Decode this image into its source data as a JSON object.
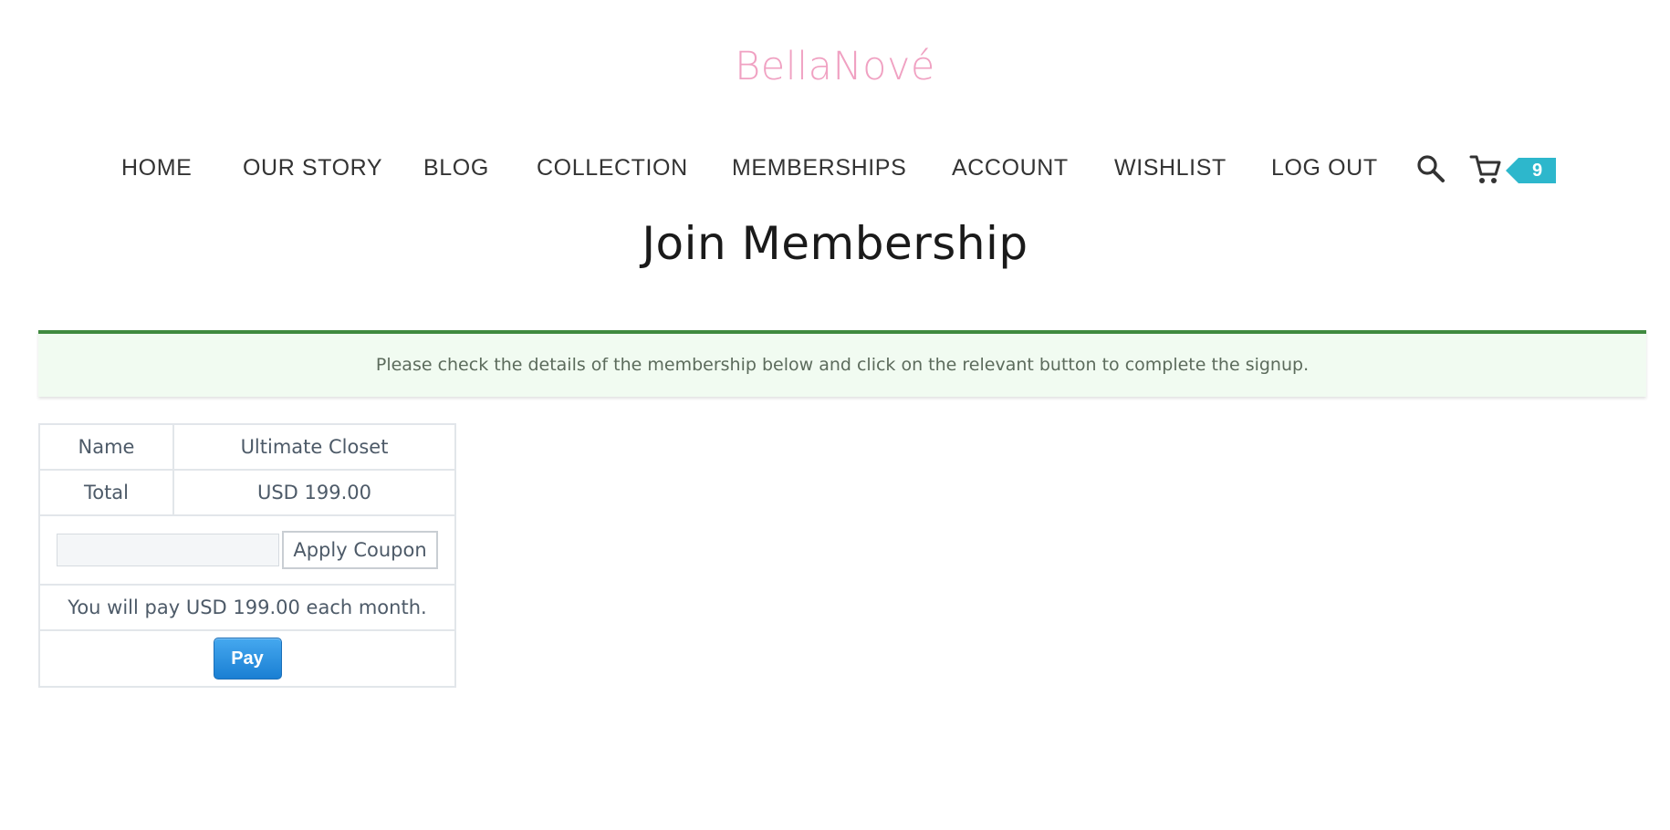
{
  "brand": {
    "logo_text": "BellaNové",
    "logo_color": "#f0a1c2"
  },
  "nav": {
    "items": [
      {
        "label": "HOME"
      },
      {
        "label": "OUR STORY"
      },
      {
        "label": "BLOG"
      },
      {
        "label": "COLLECTION"
      },
      {
        "label": "MEMBERSHIPS"
      },
      {
        "label": "ACCOUNT"
      },
      {
        "label": "WISHLIST"
      },
      {
        "label": "LOG OUT"
      }
    ],
    "icons": [
      "search-icon",
      "cart-icon"
    ],
    "cart_count": "9",
    "badge_color": "#2db7cc"
  },
  "page": {
    "title": "Join Membership"
  },
  "notice": {
    "text": "Please check the details of the membership below and click on the relevant button to complete the signup.",
    "accent_color": "#3f8a3f"
  },
  "membership": {
    "name_label": "Name",
    "name_value": "Ultimate Closet",
    "total_label": "Total",
    "total_value": "USD 199.00",
    "coupon_value": "",
    "coupon_button": "Apply Coupon",
    "pay_text": "You will pay USD 199.00 each month.",
    "pay_button": "Pay",
    "pay_button_color": "#1a7fd3"
  }
}
